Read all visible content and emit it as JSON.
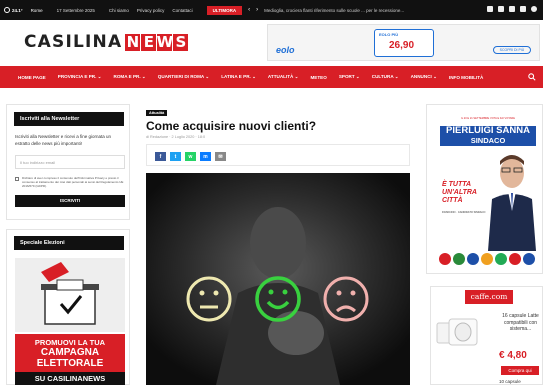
{
  "topbar": {
    "temperature": "24.1°",
    "city": "Rome",
    "date": "17 Settembre 2025",
    "links": [
      "Chi siamo",
      "Privacy policy",
      "Contattaci"
    ],
    "ultima_ora": "ULTIMORA",
    "ticker": "Medioglia, crociera flanti riferimento sulle scuole ... per le recessione..."
  },
  "logo": {
    "casilina": "CASILINA",
    "news_letters": [
      "N",
      "E",
      "W",
      "S"
    ]
  },
  "ad_banner": {
    "brand": "eolo",
    "offer_top": "EOLO PIÙ",
    "offer_price": "26,90",
    "cta": "SCOPRI DI PIÙ"
  },
  "nav": {
    "items": [
      "HOME PAGE",
      "PROVINCIA E PR. ⌄",
      "ROMA E PR. ⌄",
      "QUARTIERI DI ROMA ⌄",
      "LATINA E PR. ⌄",
      "ATTUALITÀ ⌄",
      "METEO",
      "SPORT ⌄",
      "CULTURA ⌄",
      "ANNUNCI ⌄",
      "INFO MOBILITÀ"
    ]
  },
  "newsletter": {
    "title": "Iscriviti alla Newsletter",
    "description": "Iscriviti alla Newsletter e ricevi a fine giornata un estratto delle news più importanti!",
    "email_placeholder": "Il tuo indirizzo email",
    "consent": "Dichiaro di aver compreso il contenuto dell'Informativa Privacy e presto il consenso al trattamento dei miei dati personali ai sensi del Regolamento UE 2016/679 (GDPR).",
    "button": "ISCRIVITI"
  },
  "elezioni": {
    "title": "Speciale Elezioni",
    "promo_l1": "PROMUOVI LA TUA",
    "promo_l2": "CAMPAGNA ELETTORALE",
    "promo_l3": "SU CASILINANEWS"
  },
  "article": {
    "category": "Attualità",
    "title": "Come acquisire nuovi clienti?",
    "meta": "di Redazione  ·  2 Luglio 2020 · 18:0",
    "share": [
      "f",
      "t",
      "w",
      "m",
      "✉"
    ]
  },
  "ad_right": {
    "caption": "IL 20 E 21 SETTEMBRE VOTA E FAI VOTARE",
    "name_l1": "PIERLUIGI SANNA",
    "name_l2": "SINDACO",
    "motto": "È TUTTA UN'ALTRA CITTÀ",
    "subtext": "FIUMICINO · CANDIDATO SINDACO"
  },
  "ad_caffe": {
    "brand": "caffe.com",
    "text": "16 capsule Latte compatibili con sistema...",
    "price": "€ 4,80",
    "buy": "Compra qui",
    "more": "10 capsule"
  },
  "colors": {
    "accent": "#d81f26",
    "dark": "#111111",
    "facebook": "#3b5998",
    "twitter": "#1da1f2",
    "whatsapp": "#25d366",
    "messenger": "#0a7cff",
    "mail": "#888888"
  }
}
